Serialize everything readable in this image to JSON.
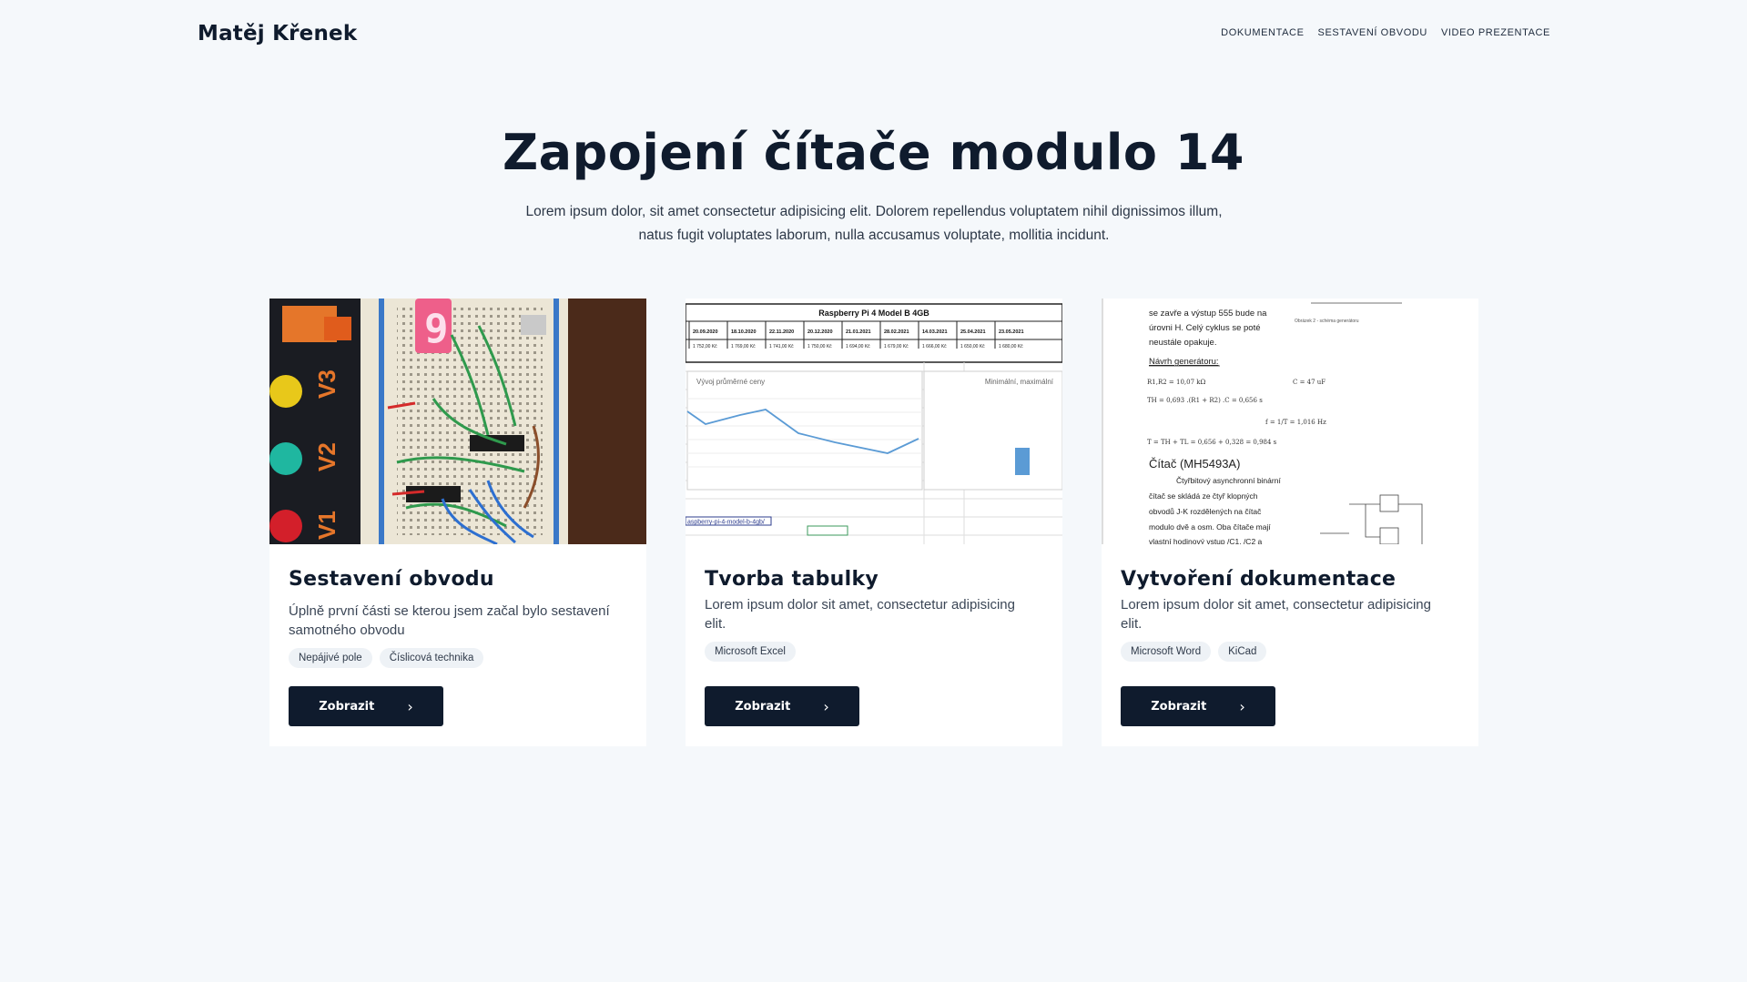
{
  "header": {
    "brand": "Matěj Křenek",
    "nav": [
      "DOKUMENTACE",
      "SESTAVENÍ OBVODU",
      "VIDEO PREZENTACE"
    ]
  },
  "hero": {
    "title": "Zapojení čítače modulo 14",
    "subtitle_line1": "Lorem ipsum dolor, sit amet consectetur adipisicing elit. Dolorem repellendus voluptatem nihil dignissimos illum,",
    "subtitle_line2": "natus fugit voluptates laborum, nulla accusamus voluptate, mollitia incidunt."
  },
  "cards": [
    {
      "title": "Sestavení obvodu",
      "description": "Úplně první části se kterou jsem začal bylo sestavení samotného obvodu",
      "tags": [
        "Nepájivé pole",
        "Číslicová technika"
      ],
      "button": "Zobrazit",
      "image": "breadboard-circuit-photo",
      "image_text": {
        "digit": "9",
        "labels": [
          "V3",
          "V2",
          "V1"
        ]
      }
    },
    {
      "title": "Tvorba tabulky",
      "description": "Lorem ipsum dolor sit amet, consectetur adipisicing elit.",
      "tags": [
        "Microsoft Excel"
      ],
      "button": "Zobrazit",
      "image": "spreadsheet-screenshot",
      "image_text": {
        "table_title": "Raspberry Pi 4 Model B 4GB",
        "chart_title": "Vývoj průměrné ceny",
        "side_title": "Minimální, maximální",
        "link": "aspberry-pi-4-model-b-4gb/",
        "dates": [
          "20.09.2020",
          "18.10.2020",
          "22.11.2020",
          "20.12.2020",
          "21.01.2021",
          "28.02.2021",
          "14.03.2021",
          "25.04.2021",
          "23.05.2021"
        ],
        "prices": [
          "1 752,00 Kč",
          "1 769,00 Kč",
          "1 741,00 Kč",
          "1 750,00 Kč",
          "1 694,00 Kč",
          "1 679,00 Kč",
          "1 666,00 Kč",
          "1 650,00 Kč",
          "1 680,00 Kč"
        ]
      }
    },
    {
      "title": "Vytvoření dokumentace",
      "description": "Lorem ipsum dolor sit amet, consectetur adipisicing elit.",
      "tags": [
        "Microsoft Word",
        "KiCad"
      ],
      "button": "Zobrazit",
      "image": "document-page-scan",
      "image_text": {
        "lines": [
          "se zavře a výstup 555 bude na",
          "úrovni H. Celý cyklus se poté",
          "neustále opakuje."
        ],
        "heading": "Návrh generátoru:",
        "formula1": "R1,R2 = 10,07 kΩ",
        "formula2": "C = 47 uF",
        "formula3": "TH = 0,693 .(R1 + R2) .C = 0,656 s",
        "formula4": "f = 1/T = 1,016 Hz",
        "formula5": "T = TH + TL = 0,656 + 0,328 = 0,984 s",
        "section": "Čítač (MH5493A)",
        "para": [
          "Čtyřbitový asynchronní binární",
          "čítač se skládá ze čtyř klopných",
          "obvodů J-K rozdělených na čítač",
          "modulo dvě a osm. Oba čítače mají",
          "vlastní hodinový vstup /C1, /C2 a"
        ],
        "caption": "Obrázek 2 - schéma generátoru"
      }
    }
  ],
  "colors": {
    "page_bg": "#f5f8fb",
    "card_bg": "#ffffff",
    "primary": "#0f1b2d",
    "tag_bg": "#eef2f6"
  }
}
